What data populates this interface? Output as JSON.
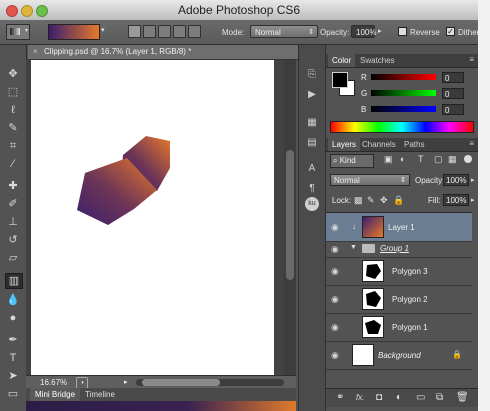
{
  "window": {
    "title": "Adobe Photoshop CS6"
  },
  "options_bar": {
    "mode_label": "Mode:",
    "mode_value": "Normal",
    "opacity_label": "Opacity:",
    "opacity_value": "100%",
    "reverse_label": "Reverse",
    "reverse_checked": false,
    "dither_label": "Dither",
    "dither_checked": true,
    "gradient_colors": [
      "#3b1f6b",
      "#e8782c"
    ]
  },
  "document": {
    "tab_title": "Clipping.psd @ 16.7% (Layer 1, RGB/8) *",
    "zoom": "16.67%"
  },
  "bottom_tabs": [
    "Mini Bridge",
    "Timeline"
  ],
  "color_panel": {
    "tabs": [
      "Color",
      "Swatches"
    ],
    "channels": [
      {
        "label": "R",
        "value": "0",
        "color": "#d94a4a"
      },
      {
        "label": "G",
        "value": "0",
        "color": "#4ab04a"
      },
      {
        "label": "B",
        "value": "0",
        "color": "#4a6ad9"
      }
    ]
  },
  "layers_panel": {
    "tabs": [
      "Layers",
      "Channels",
      "Paths"
    ],
    "kind_label": "Kind",
    "blend_mode": "Normal",
    "opacity_label": "Opacity:",
    "opacity_value": "100%",
    "lock_label": "Lock:",
    "fill_label": "Fill:",
    "fill_value": "100%",
    "layers": [
      {
        "name": "Layer 1",
        "type": "gradient",
        "selected": true
      },
      {
        "name": "Group 1",
        "type": "group",
        "selected": false
      },
      {
        "name": "Polygon 3",
        "type": "shape",
        "selected": false
      },
      {
        "name": "Polygon 2",
        "type": "shape",
        "selected": false
      },
      {
        "name": "Polygon 1",
        "type": "shape",
        "selected": false
      },
      {
        "name": "Background",
        "type": "background",
        "selected": false
      }
    ]
  },
  "icons": {
    "tools": [
      "move-icon",
      "marquee-icon",
      "lasso-icon",
      "quick-select-icon",
      "crop-icon",
      "eyedropper-icon",
      "healing-brush-icon",
      "brush-icon",
      "clone-stamp-icon",
      "history-brush-icon",
      "eraser-icon",
      "gradient-icon",
      "blur-icon",
      "dodge-icon",
      "pen-icon",
      "type-icon",
      "path-select-icon",
      "shape-icon",
      "hand-icon",
      "zoom-icon"
    ],
    "collapsed_panels": [
      "history-icon",
      "actions-icon",
      "brush-presets-icon",
      "adjustments-icon",
      "character-icon",
      "paragraph-icon",
      "kuler-icon"
    ],
    "layers_footer": [
      "link-icon",
      "fx-icon",
      "mask-icon",
      "adjustment-layer-icon",
      "new-group-icon",
      "new-layer-icon",
      "trash-icon"
    ]
  }
}
